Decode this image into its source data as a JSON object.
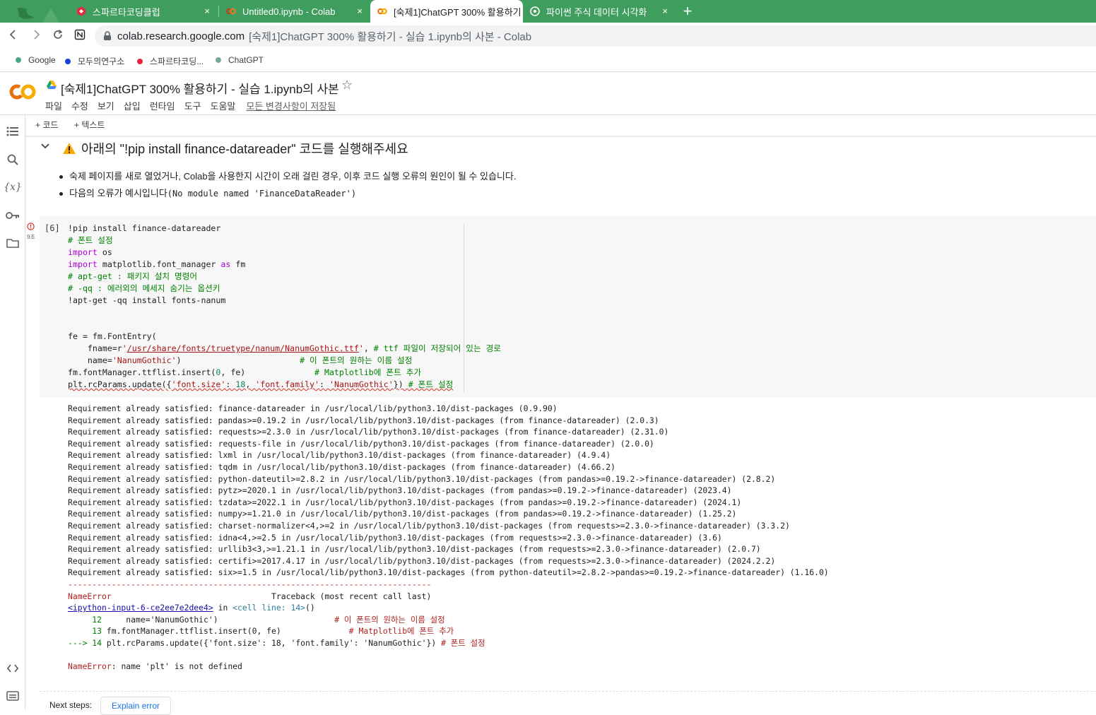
{
  "browser": {
    "tabs": [
      {
        "label": "스파르타코딩클럽",
        "favicon": "sparta-icon",
        "active": false
      },
      {
        "label": "Untitled0.ipynb - Colab",
        "favicon": "colab-icon",
        "active": false
      },
      {
        "label": "[숙제1]ChatGPT 300% 활용하기 - 실습 1.ipynb의 사본 - Colab",
        "favicon": "colab-icon",
        "active": true
      },
      {
        "label": "파이썬 주식 데이터 시각화",
        "favicon": "chatgpt-icon",
        "active": false
      }
    ],
    "tab_close": "×",
    "new_tab": "+",
    "address": {
      "domain": "colab.research.google.com",
      "title": "[숙제1]ChatGPT 300% 활용하기 - 실습 1.ipynb의 사본 - Colab"
    },
    "bookmarks": [
      {
        "label": "Google",
        "color": "#4aa58a"
      },
      {
        "label": "모두의연구소",
        "color": "#1a3fd6"
      },
      {
        "label": "스파르타코딩...",
        "color": "#e8253f"
      },
      {
        "label": "ChatGPT",
        "color": "#7aa89a"
      }
    ]
  },
  "colab": {
    "title": "[숙제1]ChatGPT 300% 활용하기 - 실습 1.ipynb의 사본",
    "menu": [
      "파일",
      "수정",
      "보기",
      "삽입",
      "런타임",
      "도구",
      "도움말"
    ],
    "saved_status": "모든 변경사항이 저장됨",
    "add_code": "+ 코드",
    "add_text": "+ 텍스트",
    "accent": "#f9ab00"
  },
  "markdown": {
    "heading": "아래의 \"!pip install finance-datareader\" 코드를 실행해주세요",
    "bullet1": "숙제 페이지를 새로 열었거나, Colab을 사용한지 시간이 오래 걸린 경우, 이후 코드 실행 오류의 원인이 될 수 있습니다.",
    "bullet2_text": "다음의 오류가 예시입니다",
    "bullet2_code": "(No module named 'FinanceDataReader')"
  },
  "cell": {
    "exec_count": "[6]",
    "elapsed": "9초",
    "code": {
      "l1": "!pip install finance-datareader",
      "l2": "# 폰트 설정",
      "l3_kw": "import",
      "l3_rest": " os",
      "l4_kw": "import",
      "l4_mid": " matplotlib.font_manager ",
      "l4_as": "as",
      "l4_end": " fm",
      "l5": "# apt-get : 패키지 설치 명령어",
      "l6": "# -qq : 에러외의 메세지 숨기는 옵션키",
      "l7": "!apt-get -qq install fonts-nanum",
      "l8": "fe = fm.FontEntry(",
      "l9_a": "    fname=r",
      "l9_q1": "'",
      "l9_link": "/usr/share/fonts/truetype/nanum/NanumGothic.ttf",
      "l9_q2": "'",
      "l9_b": ", ",
      "l9_com": "# ttf 파일이 저장되어 있는 경로",
      "l10_a": "    name=",
      "l10_str": "'NanumGothic'",
      "l10_b": ")                        ",
      "l10_com": "# 이 폰트의 원하는 이름 설정",
      "l11_a": "fm.fontManager.ttflist.insert(",
      "l11_num": "0",
      "l11_b": ", fe)              ",
      "l11_com": "# Matplotlib에 폰트 추가",
      "l12_a": "plt.rcParams.update({",
      "l12_s1": "'font.size'",
      "l12_b": ": ",
      "l12_num": "18",
      "l12_c": ", ",
      "l12_s2": "'font.family'",
      "l12_d": ": ",
      "l12_s3": "'NanumGothic'",
      "l12_e": "}) ",
      "l12_com": "# 폰트 설정"
    },
    "output": {
      "requirements": [
        "Requirement already satisfied: finance-datareader in /usr/local/lib/python3.10/dist-packages (0.9.90)",
        "Requirement already satisfied: pandas>=0.19.2 in /usr/local/lib/python3.10/dist-packages (from finance-datareader) (2.0.3)",
        "Requirement already satisfied: requests>=2.3.0 in /usr/local/lib/python3.10/dist-packages (from finance-datareader) (2.31.0)",
        "Requirement already satisfied: requests-file in /usr/local/lib/python3.10/dist-packages (from finance-datareader) (2.0.0)",
        "Requirement already satisfied: lxml in /usr/local/lib/python3.10/dist-packages (from finance-datareader) (4.9.4)",
        "Requirement already satisfied: tqdm in /usr/local/lib/python3.10/dist-packages (from finance-datareader) (4.66.2)",
        "Requirement already satisfied: python-dateutil>=2.8.2 in /usr/local/lib/python3.10/dist-packages (from pandas>=0.19.2->finance-datareader) (2.8.2)",
        "Requirement already satisfied: pytz>=2020.1 in /usr/local/lib/python3.10/dist-packages (from pandas>=0.19.2->finance-datareader) (2023.4)",
        "Requirement already satisfied: tzdata>=2022.1 in /usr/local/lib/python3.10/dist-packages (from pandas>=0.19.2->finance-datareader) (2024.1)",
        "Requirement already satisfied: numpy>=1.21.0 in /usr/local/lib/python3.10/dist-packages (from pandas>=0.19.2->finance-datareader) (1.25.2)",
        "Requirement already satisfied: charset-normalizer<4,>=2 in /usr/local/lib/python3.10/dist-packages (from requests>=2.3.0->finance-datareader) (3.3.2)",
        "Requirement already satisfied: idna<4,>=2.5 in /usr/local/lib/python3.10/dist-packages (from requests>=2.3.0->finance-datareader) (3.6)",
        "Requirement already satisfied: urllib3<3,>=1.21.1 in /usr/local/lib/python3.10/dist-packages (from requests>=2.3.0->finance-datareader) (2.0.7)",
        "Requirement already satisfied: certifi>=2017.4.17 in /usr/local/lib/python3.10/dist-packages (from requests>=2.3.0->finance-datareader) (2024.2.2)",
        "Requirement already satisfied: six>=1.5 in /usr/local/lib/python3.10/dist-packages (from python-dateutil>=2.8.2->pandas>=0.19.2->finance-datareader) (1.16.0)"
      ],
      "dashes": "---------------------------------------------------------------------------",
      "err_name": "NameError",
      "traceback_label": "                                 Traceback (most recent call last)",
      "input_link": "<ipython-input-6-ce2ee7e2dee4>",
      "in_word": " in ",
      "cell_line": "<cell line: 14>",
      "paren": "()",
      "tb1_num": "     12 ",
      "tb1_code": "    name='NanumGothic')                        ",
      "tb1_com": "# 이 폰트의 원하는 이름 설정",
      "tb2_num": "     13 ",
      "tb2_code": "fm.fontManager.ttflist.insert(0, fe)              ",
      "tb2_com": "# Matplotlib에 폰트 추가",
      "tb3_arrow": "---> 14 ",
      "tb3_code": "plt.rcParams.update({'font.size': 18, 'font.family': 'NanumGothic'}) ",
      "tb3_com": "# 폰트 설정",
      "final_name": "NameError",
      "final_msg": ": name 'plt' is not defined"
    }
  },
  "next_steps": {
    "label": "Next steps:",
    "button": "Explain error"
  }
}
